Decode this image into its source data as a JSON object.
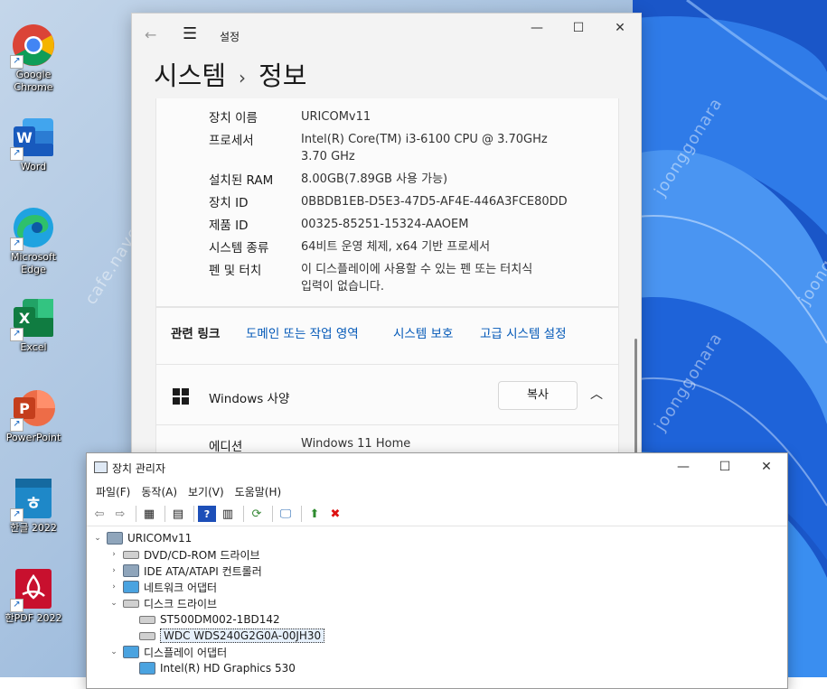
{
  "desktop": {
    "icons": [
      {
        "label": "Google\nChrome",
        "icon": "chrome-icon"
      },
      {
        "label": "Word",
        "icon": "word-icon"
      },
      {
        "label": "Microsoft\nEdge",
        "icon": "edge-icon"
      },
      {
        "label": "Excel",
        "icon": "excel-icon"
      },
      {
        "label": "PowerPoint",
        "icon": "powerpoint-icon"
      },
      {
        "label": "한글 2022",
        "icon": "hangul-icon"
      },
      {
        "label": "한PDF 2022",
        "icon": "hanpdf-icon"
      }
    ],
    "watermarks": [
      "cafe.naver.com/joonggonara",
      "joonggonara",
      "joonggonara",
      "joonggonara"
    ]
  },
  "settings": {
    "window_title": "설정",
    "breadcrumb_parent": "시스템",
    "breadcrumb_sep": "›",
    "breadcrumb_current": "정보",
    "info_rows": [
      {
        "label": "장치 이름",
        "value": "URICOMv11"
      },
      {
        "label": "프로세서",
        "value": "Intel(R) Core(TM) i3-6100 CPU @ 3.70GHz\n3.70 GHz"
      },
      {
        "label": "설치된 RAM",
        "value": "8.00GB(7.89GB 사용 가능)"
      },
      {
        "label": "장치 ID",
        "value": "0BBDB1EB-D5E3-47D5-AF4E-446A3FCE80DD"
      },
      {
        "label": "제품 ID",
        "value": "00325-85251-15324-AAOEM"
      },
      {
        "label": "시스템 종류",
        "value": "64비트 운영 체제, x64 기반 프로세서"
      },
      {
        "label": "펜 및 터치",
        "value": "이 디스플레이에 사용할 수 있는 펜 또는 터치식\n입력이 없습니다."
      }
    ],
    "related": {
      "label": "관련 링크",
      "links": [
        "도메인 또는 작업 영역",
        "시스템 보호",
        "고급 시스템 설정"
      ]
    },
    "windows_spec": {
      "title": "Windows 사양",
      "copy_label": "복사",
      "rows": [
        {
          "label": "에디션",
          "value": "Windows 11 Home"
        }
      ]
    }
  },
  "device_manager": {
    "window_title": "장치 관리자",
    "menu": [
      "파일(F)",
      "동작(A)",
      "보기(V)",
      "도움말(H)"
    ],
    "tree": [
      {
        "level": 0,
        "expander": "⌄",
        "icon": "computer-icon",
        "label": "URICOMv11"
      },
      {
        "level": 1,
        "expander": "›",
        "icon": "dvd-drive-icon",
        "label": "DVD/CD-ROM 드라이브"
      },
      {
        "level": 1,
        "expander": "›",
        "icon": "ide-controller-icon",
        "label": "IDE ATA/ATAPI 컨트롤러"
      },
      {
        "level": 1,
        "expander": "›",
        "icon": "network-adapter-icon",
        "label": "네트워크 어댑터"
      },
      {
        "level": 1,
        "expander": "⌄",
        "icon": "disk-drive-icon",
        "label": "디스크 드라이브"
      },
      {
        "level": 2,
        "expander": "",
        "icon": "disk-drive-icon",
        "label": "ST500DM002-1BD142"
      },
      {
        "level": 2,
        "expander": "",
        "icon": "disk-drive-icon",
        "label": "WDC WDS240G2G0A-00JH30",
        "selected": true
      },
      {
        "level": 1,
        "expander": "⌄",
        "icon": "display-adapter-icon",
        "label": "디스플레이 어댑터"
      },
      {
        "level": 2,
        "expander": "",
        "icon": "display-adapter-icon",
        "label": "Intel(R) HD Graphics 530"
      }
    ]
  }
}
